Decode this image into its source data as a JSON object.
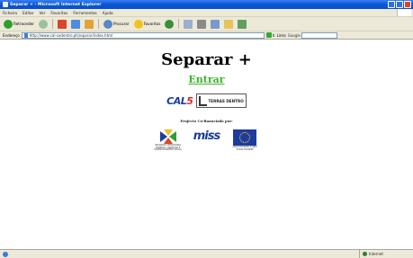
{
  "window": {
    "title": "Separar + - Microsoft Internet Explorer"
  },
  "menu": [
    "Ficheiro",
    "Editar",
    "Ver",
    "Favoritos",
    "Ferramentas",
    "Ajuda"
  ],
  "toolbar": {
    "back_label": "Retroceder",
    "search_label": "Procurar",
    "favorites_label": "Favoritos"
  },
  "address": {
    "label": "Endereço",
    "url": "http://www.cal-sadentro.pt/separar/index.html",
    "go_label": "Ir",
    "links_label": "Links",
    "google_label": "Google"
  },
  "page": {
    "title": "Separar +",
    "entrar_link": "Entrar",
    "cal_logo_prefix": "CAL",
    "cal_logo_accent": "5",
    "terras_logo": "TERRAS DENTRO",
    "cofin_text": "Projecto Co-financiado por:",
    "sponsor_left_caption": "PROGRAMA OPERACIONAL EMPREGO, FORMAÇÃO E DESENVOLVIMENTO SOCIAL",
    "sponsor_middle_logo": "miss",
    "sponsor_right_caption": "UNIÃO EUROPEIA FUNDO SOCIAL EUROPEU"
  },
  "status": {
    "zone_label": "Internet"
  },
  "colors": {
    "link_green": "#3cb52d",
    "titlebar_blue": "#0a56d8"
  }
}
